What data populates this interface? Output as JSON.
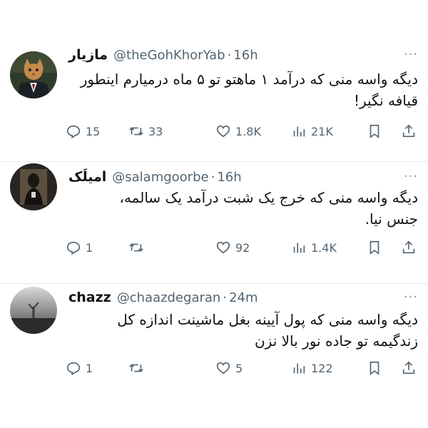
{
  "tweets": [
    {
      "name": "مازیار",
      "handle": "@theGohKhorYab",
      "time": "16h",
      "text": "دیگه واسه منی که درآمد ۱ ماهتو تو ۵ ماه درمیارم اینطور\nقیافه نگیر!",
      "replies": "15",
      "retweets": "33",
      "likes": "1.8K",
      "views": "21K",
      "avatar": "cat-in-suit-avatar"
    },
    {
      "name": "امیلَک",
      "handle": "@salamgoorbe",
      "time": "16h",
      "text": "دیگه واسه منی که خرج یک شبت درآمد یک سالمه،\nجنس نیا.",
      "replies": "1",
      "retweets": "",
      "likes": "92",
      "views": "1.4K",
      "avatar": "dark-portrait-avatar"
    },
    {
      "name": "chazz",
      "handle": "@chaazdegaran",
      "time": "24m",
      "text": "دیگه واسه منی که پول آیینه بغل ماشینت اندازه کل\nزندگیمه تو جاده نور بالا نزن",
      "replies": "1",
      "retweets": "",
      "likes": "5",
      "views": "122",
      "avatar": "foggy-tree-avatar"
    }
  ],
  "ui": {
    "separator": "·",
    "more_label": "···"
  },
  "colors": {
    "text": "#0f1419",
    "muted": "#536471",
    "border": "#e6e9ec"
  }
}
